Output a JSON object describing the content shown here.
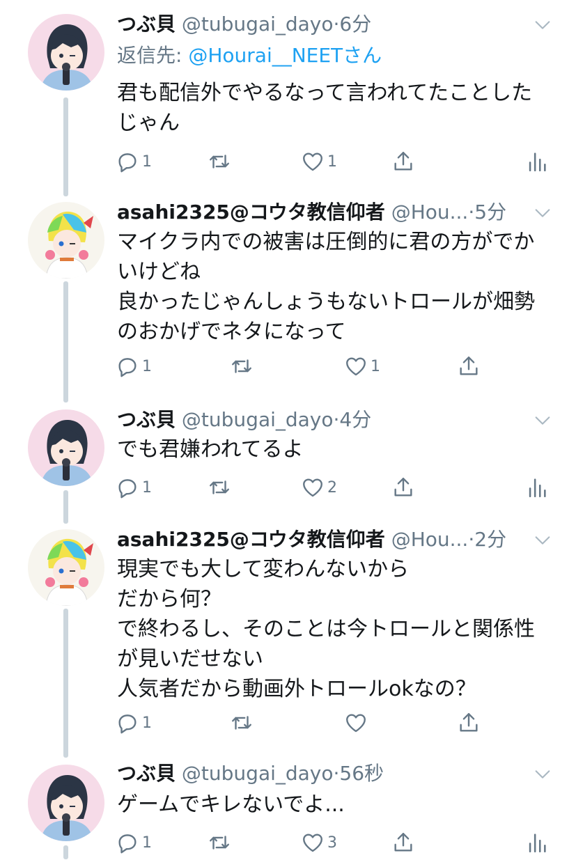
{
  "tweets": [
    {
      "name": "つぶ貝",
      "handle": "@tubugai_dayo",
      "time": "6分",
      "replyto_prefix": "返信先: ",
      "replyto_handle": "@Hourai__NEETさん",
      "lines": [
        "君も配信外でやるなって言われてたことした",
        "じゃん"
      ],
      "reply_count": "1",
      "retweet_count": "",
      "like_count": "1"
    },
    {
      "name": "asahi2325@コウタ教信仰者",
      "handle": "@Hou...",
      "time": "5分",
      "lines": [
        "マイクラ内での被害は圧倒的に君の方がでか",
        "いけどね",
        "良かったじゃんしょうもないトロールが畑勢",
        "のおかげでネタになって"
      ],
      "reply_count": "1",
      "retweet_count": "",
      "like_count": "1"
    },
    {
      "name": "つぶ貝",
      "handle": "@tubugai_dayo",
      "time": "4分",
      "lines": [
        "でも君嫌われてるよ"
      ],
      "reply_count": "1",
      "retweet_count": "",
      "like_count": "2"
    },
    {
      "name": "asahi2325@コウタ教信仰者",
      "handle": "@Hou...",
      "time": "2分",
      "lines": [
        "現実でも大して変わんないから",
        "だから何？",
        "で終わるし、そのことは今トロールと関係性",
        "が見いだせない",
        "人気者だから動画外トロールokなの？"
      ],
      "reply_count": "1",
      "retweet_count": "",
      "like_count": ""
    },
    {
      "name": "つぶ貝",
      "handle": "@tubugai_dayo",
      "time": "56秒",
      "lines": [
        "ゲームでキレないでよ..."
      ],
      "reply_count": "1",
      "retweet_count": "",
      "like_count": "3"
    }
  ],
  "ui": {
    "separator": "·"
  },
  "icons": [
    "reply-icon",
    "retweet-icon",
    "like-icon",
    "share-icon",
    "analytics-icon",
    "chevron-down-icon"
  ],
  "colors": {
    "link": "#1da1f2",
    "muted": "#657786",
    "text": "#14171a",
    "thread_line": "#ccd6dd"
  }
}
